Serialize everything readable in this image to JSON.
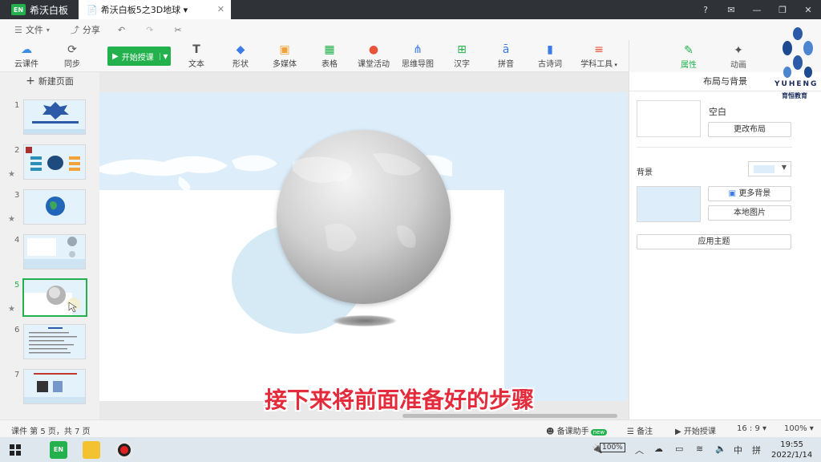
{
  "titlebar": {
    "app_name": "希沃白板",
    "tab_title": "希沃白板5之3D地球 ▾",
    "tab_close": "✕"
  },
  "menu": {
    "file": "文件",
    "share": "分享"
  },
  "toolbar": {
    "cloud": "云课件",
    "sync": "同步",
    "start_teach": "开始授课",
    "items": [
      "文本",
      "形状",
      "多媒体",
      "表格",
      "课堂活动",
      "思维导图",
      "汉字",
      "拼音",
      "古诗词",
      "学科工具"
    ]
  },
  "slides_panel": {
    "new_page": "新建页面",
    "numbers": [
      "1",
      "2",
      "3",
      "4",
      "5",
      "6",
      "7"
    ],
    "active": 5
  },
  "subtitle": "接下来将前面准备好的步骤",
  "right_panel": {
    "tab_property": "属性",
    "tab_animation": "动画",
    "header": "布局与背景",
    "layout_name": "空白",
    "change_layout": "更改布局",
    "background_label": "背景",
    "more_backgrounds": "更多背景",
    "local_image": "本地图片",
    "apply_theme": "应用主题",
    "bg_color": "#ddeefa"
  },
  "logo": {
    "brand_en": "YUHENG",
    "brand_cn": "育恒教育"
  },
  "statusbar": {
    "page_info": "课件 第 5 页，共 7 页",
    "assistant": "备课助手",
    "new_badge": "new",
    "notes": "备注",
    "start_teach": "开始授课",
    "ratio": "16 : 9 ▾",
    "zoom": "100% ▾"
  },
  "taskbar": {
    "battery": "100%",
    "ime_mode": "中",
    "ime_type": "拼",
    "time": "19:55",
    "date": "2022/1/14"
  }
}
